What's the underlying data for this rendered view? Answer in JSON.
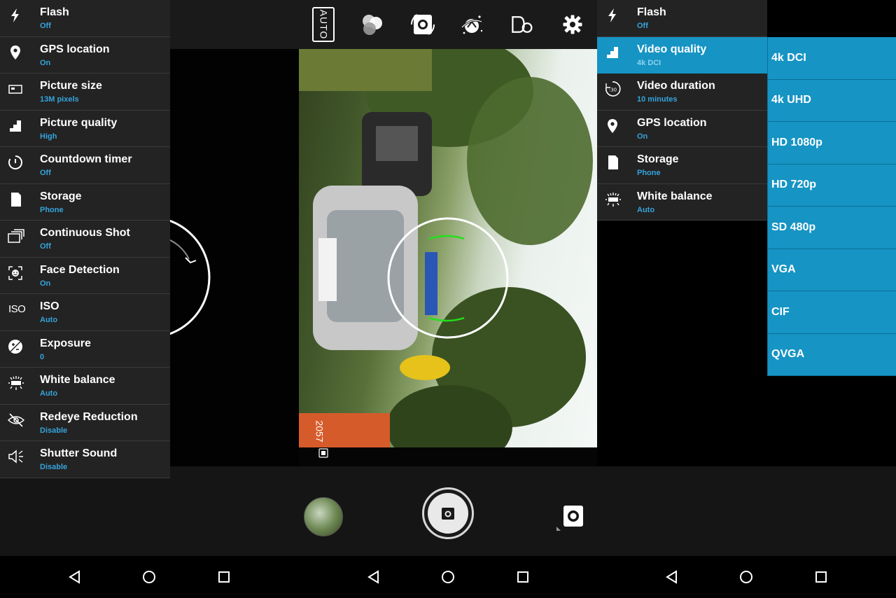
{
  "left_settings": [
    {
      "title": "Flash",
      "value": "Off",
      "icon": "flash-icon"
    },
    {
      "title": "GPS location",
      "value": "On",
      "icon": "location-pin-icon"
    },
    {
      "title": "Picture size",
      "value": "13M pixels",
      "icon": "picture-size-icon"
    },
    {
      "title": "Picture quality",
      "value": "High",
      "icon": "quality-steps-icon"
    },
    {
      "title": "Countdown timer",
      "value": "Off",
      "icon": "timer-icon"
    },
    {
      "title": "Storage",
      "value": "Phone",
      "icon": "sd-card-icon"
    },
    {
      "title": "Continuous Shot",
      "value": "Off",
      "icon": "burst-icon"
    },
    {
      "title": "Face Detection",
      "value": "On",
      "icon": "face-detection-icon"
    },
    {
      "title": "ISO",
      "value": "Auto",
      "icon": "iso-icon",
      "icon_text": "ISO"
    },
    {
      "title": "Exposure",
      "value": "0",
      "icon": "exposure-icon"
    },
    {
      "title": "White balance",
      "value": "Auto",
      "icon": "white-balance-icon"
    },
    {
      "title": "Redeye Reduction",
      "value": "Disable",
      "icon": "redeye-icon"
    },
    {
      "title": "Shutter Sound",
      "value": "Disable",
      "icon": "speaker-icon"
    }
  ],
  "center": {
    "top_bar": {
      "auto_label": "AUTO",
      "icons": [
        "color-effects-icon",
        "switch-camera-icon",
        "scene-mode-icon",
        "filter-icon",
        "settings-gear-icon"
      ]
    },
    "shot_count": "2057",
    "shutter_mode": "photo"
  },
  "right_settings": [
    {
      "title": "Flash",
      "value": "Off",
      "icon": "flash-icon"
    },
    {
      "title": "Video quality",
      "value": "4k DCI",
      "icon": "quality-steps-icon",
      "selected": true
    },
    {
      "title": "Video duration",
      "value": "10 minutes",
      "icon": "video-duration-icon"
    },
    {
      "title": "GPS location",
      "value": "On",
      "icon": "location-pin-icon"
    },
    {
      "title": "Storage",
      "value": "Phone",
      "icon": "sd-card-icon"
    },
    {
      "title": "White balance",
      "value": "Auto",
      "icon": "white-balance-icon"
    }
  ],
  "video_quality_options": [
    "4k DCI",
    "4k UHD",
    "HD 1080p",
    "HD 720p",
    "SD 480p",
    "VGA",
    "CIF",
    "QVGA"
  ],
  "nav_buttons": [
    "back",
    "home",
    "recents"
  ],
  "colors": {
    "accent": "#1694c4",
    "value_text": "#35a4dc",
    "panel_bg": "#232323",
    "focus_green": "#22e11a"
  }
}
